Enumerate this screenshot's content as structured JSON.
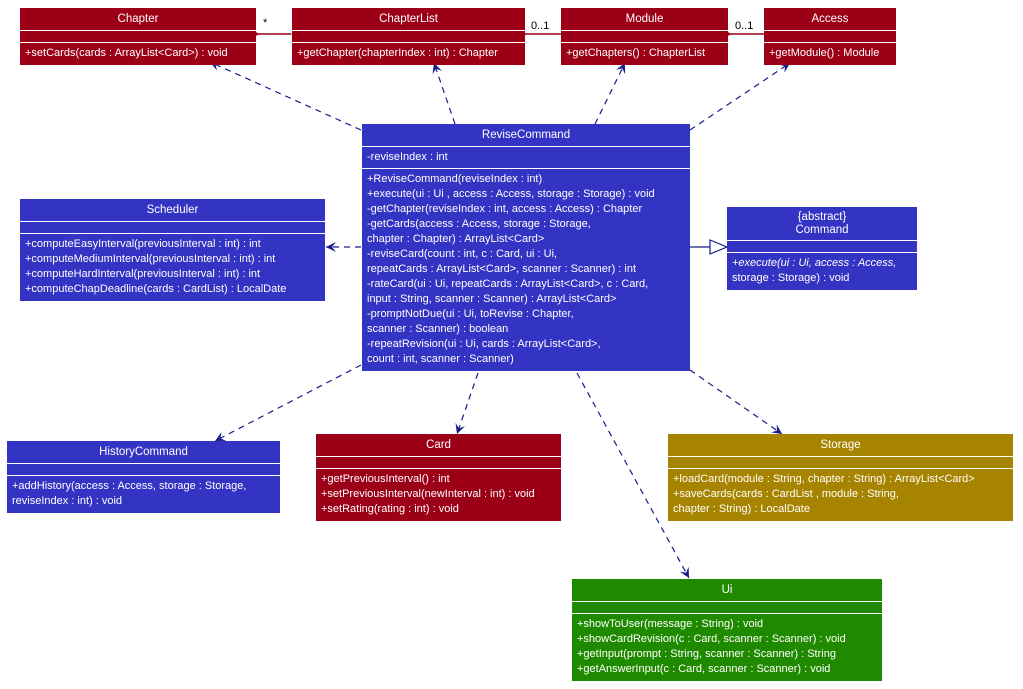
{
  "colors": {
    "entity": "#9b0016",
    "logic": "#3333c4",
    "storage": "#a78400",
    "ui": "#1f8a00",
    "dependency_line": "#1a1a8c",
    "composition_line": "#9b0016"
  },
  "classes": {
    "chapter": {
      "name": "Chapter",
      "attributes": [],
      "operations": [
        "+setCards(cards : ArrayList<Card>) : void"
      ]
    },
    "chapterlist": {
      "name": "ChapterList",
      "attributes": [],
      "operations": [
        "+getChapter(chapterIndex : int) : Chapter"
      ]
    },
    "module": {
      "name": "Module",
      "attributes": [],
      "operations": [
        "+getChapters() : ChapterList"
      ]
    },
    "access": {
      "name": "Access",
      "attributes": [],
      "operations": [
        "+getModule() : Module"
      ]
    },
    "revisecommand": {
      "name": "ReviseCommand",
      "attributes": [
        "-reviseIndex : int"
      ],
      "operations": [
        "+ReviseCommand(reviseIndex : int)",
        "+execute(ui : Ui , access : Access, storage : Storage) : void",
        "-getChapter(reviseIndex : int, access : Access) : Chapter",
        "-getCards(access : Access, storage : Storage,",
        "chapter : Chapter) : ArrayList<Card>",
        "-reviseCard(count : int, c : Card, ui : Ui,",
        "repeatCards : ArrayList<Card>, scanner : Scanner) : int",
        "-rateCard(ui : Ui, repeatCards : ArrayList<Card>, c : Card,",
        "input : String, scanner : Scanner) : ArrayList<Card>",
        "-promptNotDue(ui : Ui, toRevise : Chapter,",
        "scanner : Scanner) : boolean",
        "-repeatRevision(ui : Ui, cards : ArrayList<Card>,",
        "count : int, scanner : Scanner)"
      ]
    },
    "scheduler": {
      "name": "Scheduler",
      "attributes": [],
      "operations": [
        "+computeEasyInterval(previousInterval : int) : int",
        "+computeMediumInterval(previousInterval : int) : int",
        "+computeHardInterval(previousInterval : int) : int",
        "+computeChapDeadline(cards : CardList) : LocalDate"
      ]
    },
    "command": {
      "stereotype": "{abstract}",
      "name": "Command",
      "attributes": [],
      "operations": [
        "+execute(ui : Ui, access : Access,",
        "storage : Storage) : void"
      ]
    },
    "historycommand": {
      "name": "HistoryCommand",
      "attributes": [],
      "operations": [
        "+addHistory(access : Access, storage : Storage,",
        "reviseIndex : int) : void"
      ]
    },
    "card": {
      "name": "Card",
      "attributes": [],
      "operations": [
        "+getPreviousInterval() : int",
        "+setPreviousInterval(newInterval : int) : void",
        "+setRating(rating : int) : void"
      ]
    },
    "storage": {
      "name": "Storage",
      "attributes": [],
      "operations": [
        "+loadCard(module : String, chapter : String) : ArrayList<Card>",
        "+saveCards(cards : CardList , module : String,",
        "chapter : String) : LocalDate"
      ]
    },
    "ui": {
      "name": "Ui",
      "attributes": [],
      "operations": [
        "+showToUser(message : String) : void",
        "+showCardRevision(c : Card, scanner : Scanner) : void",
        "+getInput(prompt : String, scanner : Scanner) : String",
        "+getAnswerInput(c : Card, scanner : Scanner) : void"
      ]
    }
  },
  "relationships": [
    {
      "type": "composition",
      "from": "chapterlist",
      "to": "chapter",
      "multiplicity": "*"
    },
    {
      "type": "composition",
      "from": "module",
      "to": "chapterlist",
      "multiplicity": "0..1"
    },
    {
      "type": "composition",
      "from": "access",
      "to": "module",
      "multiplicity": "0..1"
    },
    {
      "type": "dependency",
      "from": "revisecommand",
      "to": "chapter"
    },
    {
      "type": "dependency",
      "from": "revisecommand",
      "to": "chapterlist"
    },
    {
      "type": "dependency",
      "from": "revisecommand",
      "to": "module"
    },
    {
      "type": "dependency",
      "from": "revisecommand",
      "to": "access"
    },
    {
      "type": "dependency",
      "from": "revisecommand",
      "to": "scheduler"
    },
    {
      "type": "inheritance",
      "from": "revisecommand",
      "to": "command"
    },
    {
      "type": "dependency",
      "from": "revisecommand",
      "to": "historycommand"
    },
    {
      "type": "dependency",
      "from": "revisecommand",
      "to": "card"
    },
    {
      "type": "dependency",
      "from": "revisecommand",
      "to": "storage"
    },
    {
      "type": "dependency",
      "from": "revisecommand",
      "to": "ui"
    }
  ],
  "labels": {
    "mult_chapter": "*",
    "mult_chapterlist": "0..1",
    "mult_module": "0..1"
  }
}
